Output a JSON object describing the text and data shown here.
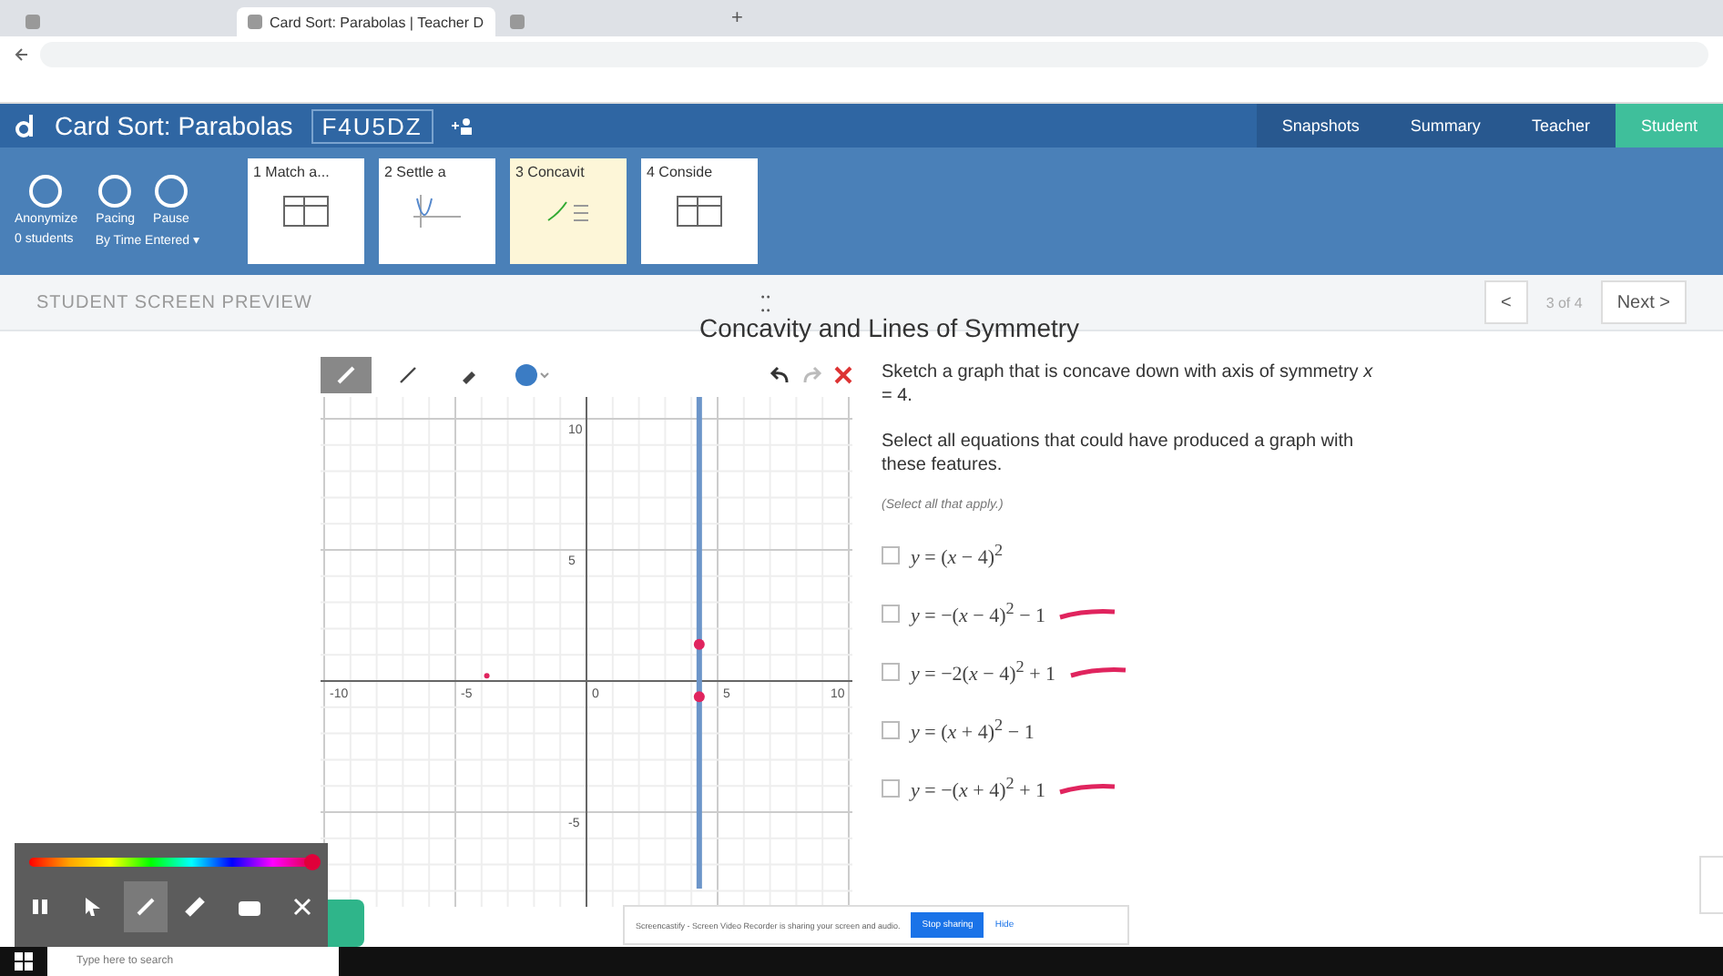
{
  "browser": {
    "tabs": [
      {
        "selected": false
      },
      {
        "title": "Card Sort: Parabolas | Teacher D",
        "selected": true
      },
      {
        "selected": false
      }
    ],
    "new_tab": "+"
  },
  "app_header": {
    "title": "Card Sort: Parabolas",
    "code": "F4U5DZ",
    "views": [
      {
        "label": "Snapshots",
        "selected": false
      },
      {
        "label": "Summary",
        "selected": false
      },
      {
        "label": "Teacher",
        "selected": false
      },
      {
        "label": "Student",
        "selected": true
      }
    ]
  },
  "controls": [
    {
      "label": "Anonymize"
    },
    {
      "label": "Pacing"
    },
    {
      "label": "Pause"
    }
  ],
  "students": "0 students",
  "sort": "By Time Entered ▾",
  "cards": [
    {
      "title": "1 Match a...",
      "kind": "table",
      "selected": false
    },
    {
      "title": "2 Settle a",
      "kind": "graph",
      "selected": false
    },
    {
      "title": "3 Concavit",
      "kind": "sketch",
      "selected": true
    },
    {
      "title": "4 Conside",
      "kind": "table",
      "selected": false
    }
  ],
  "preview": {
    "label": "STUDENT SCREEN PREVIEW",
    "handle": "⁚⁚",
    "prev": "<",
    "page": "3 of 4",
    "next": "Next >"
  },
  "screen": {
    "heading": "Concavity and Lines of Symmetry",
    "prompt": "Sketch a graph that is concave down with axis of symmetry *x* = 4.",
    "question": "Select all equations that could have produced a graph with these features.",
    "hint": "(Select all that apply.)",
    "options": [
      {
        "equation": "*y* = (*x* − 4)$^{2}$",
        "checked": false,
        "pen_mark": false
      },
      {
        "equation": "*y* = −(*x* − 4)$^{2}$ − 1",
        "checked": false,
        "pen_mark": true
      },
      {
        "equation": "*y* = −2(*x* − 4)$^{2}$ + 1",
        "checked": false,
        "pen_mark": true
      },
      {
        "equation": "*y* = (*x* + 4)$^{2}$ − 1",
        "checked": false,
        "pen_mark": false
      },
      {
        "equation": "*y* = −(*x* + 4)$^{2}$ + 1",
        "checked": false,
        "pen_mark": true
      }
    ],
    "tools": [
      {
        "kind": "pen",
        "selected": true
      },
      {
        "kind": "line",
        "selected": false
      },
      {
        "kind": "eraser",
        "selected": false
      },
      {
        "kind": "color",
        "selected": false
      }
    ],
    "graph": {
      "x_labels": [
        "-10",
        "-5",
        "0",
        "5",
        "10"
      ],
      "y_labels": [
        "10",
        "5",
        "-5"
      ]
    }
  },
  "recorder": {
    "color": {
      "level": 1
    },
    "tools": [
      {
        "kind": "pause",
        "selected": false
      },
      {
        "kind": "cursor",
        "selected": false
      },
      {
        "kind": "pen",
        "selected": true
      },
      {
        "kind": "highlighter",
        "selected": false
      },
      {
        "kind": "camera",
        "selected": false
      },
      {
        "kind": "close",
        "selected": false
      }
    ]
  },
  "share_banner": {
    "message": "Screencastify - Screen Video Recorder is sharing your screen and audio.",
    "stop": "Stop sharing",
    "hide": "Hide"
  },
  "taskbar": {
    "search": "Type here to search"
  }
}
